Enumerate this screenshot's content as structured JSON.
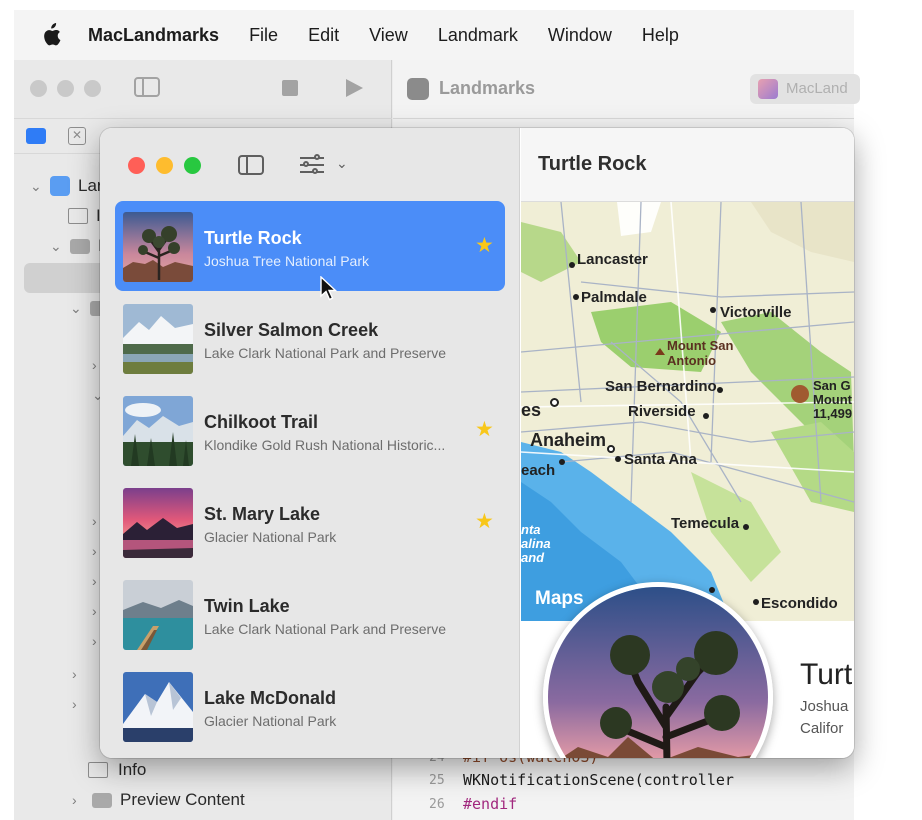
{
  "menubar": {
    "app_name": "MacLandmarks",
    "items": [
      "File",
      "Edit",
      "View",
      "Landmark",
      "Window",
      "Help"
    ]
  },
  "xcode": {
    "project_label": "Landmarks",
    "scheme_label": "MacLand",
    "tree_partial": [
      "Lar",
      "I",
      "I"
    ],
    "tree_info": "Info",
    "tree_preview": "Preview Content",
    "code_lines": [
      {
        "num": "24",
        "text": "#if os(watchOS)"
      },
      {
        "num": "25",
        "text": "    WKNotificationScene(controller"
      },
      {
        "num": "26",
        "text": "#endif"
      }
    ]
  },
  "landmarks": [
    {
      "name": "Turtle Rock",
      "park": "Joshua Tree National Park",
      "favorite": true,
      "selected": true,
      "thumb": "turtle-rock-thumbnail"
    },
    {
      "name": "Silver Salmon Creek",
      "park": "Lake Clark National Park and Preserve",
      "favorite": false,
      "selected": false,
      "thumb": "silver-salmon-creek-thumbnail"
    },
    {
      "name": "Chilkoot Trail",
      "park": "Klondike Gold Rush National Historic...",
      "favorite": true,
      "selected": false,
      "thumb": "chilkoot-trail-thumbnail"
    },
    {
      "name": "St. Mary Lake",
      "park": "Glacier National Park",
      "favorite": true,
      "selected": false,
      "thumb": "st-mary-lake-thumbnail"
    },
    {
      "name": "Twin Lake",
      "park": "Lake Clark National Park and Preserve",
      "favorite": false,
      "selected": false,
      "thumb": "twin-lake-thumbnail"
    },
    {
      "name": "Lake McDonald",
      "park": "Glacier National Park",
      "favorite": false,
      "selected": false,
      "thumb": "lake-mcdonald-thumbnail"
    }
  ],
  "detail": {
    "toolbar_title": "Turtle Rock",
    "name_partial": "Turt",
    "park_partial": "Joshua",
    "state_partial": "Califor",
    "maps_logo": "Maps",
    "map_labels": {
      "lancaster": "Lancaster",
      "palmdale": "Palmdale",
      "victorville": "Victorville",
      "mount_san_antonio_1": "Mount San",
      "mount_san_antonio_2": "Antonio",
      "san_bernardino": "San Bernardino",
      "san_g_1": "San G",
      "san_g_2": "Mount",
      "san_g_3": "11,499",
      "los_angeles_partial": "es",
      "riverside": "Riverside",
      "anaheim": "Anaheim",
      "santa_ana": "Santa Ana",
      "long_beach_partial": "each",
      "temecula": "Temecula",
      "santa_catalina_1": "nta",
      "santa_catalina_2": "alina",
      "santa_catalina_3": "and",
      "escondido": "Escondido"
    }
  },
  "colors": {
    "selection": "#4b8df8",
    "star": "#f8c71a",
    "sidebar_bg": "#e7e7e7"
  }
}
